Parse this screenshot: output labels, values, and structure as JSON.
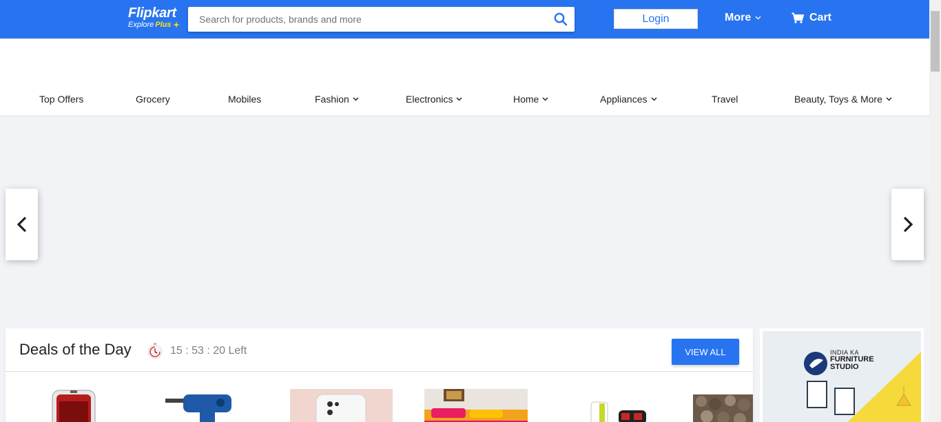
{
  "header": {
    "logo": {
      "brand": "Flipkart",
      "tagline": "Explore",
      "tagline_plus": "Plus"
    },
    "search": {
      "placeholder": "Search for products, brands and more",
      "value": ""
    },
    "login_label": "Login",
    "more_label": "More",
    "cart_label": "Cart",
    "colors": {
      "primary": "#2874f0",
      "accent": "#ffe500"
    }
  },
  "nav": {
    "items": [
      {
        "label": "Top Offers",
        "has_dropdown": false
      },
      {
        "label": "Grocery",
        "has_dropdown": false
      },
      {
        "label": "Mobiles",
        "has_dropdown": false
      },
      {
        "label": "Fashion",
        "has_dropdown": true
      },
      {
        "label": "Electronics",
        "has_dropdown": true
      },
      {
        "label": "Home",
        "has_dropdown": true
      },
      {
        "label": "Appliances",
        "has_dropdown": true
      },
      {
        "label": "Travel",
        "has_dropdown": false
      },
      {
        "label": "Beauty, Toys & More",
        "has_dropdown": true
      }
    ]
  },
  "carousel": {
    "prev_icon": "chevron-left-icon",
    "next_icon": "chevron-right-icon"
  },
  "deals": {
    "title": "Deals of the Day",
    "timer": "15 : 53 : 20 Left",
    "view_all_label": "VIEW ALL"
  },
  "promo": {
    "line1": "INDIA KA",
    "line2": "FURNITURE",
    "line3": "STUDIO"
  }
}
